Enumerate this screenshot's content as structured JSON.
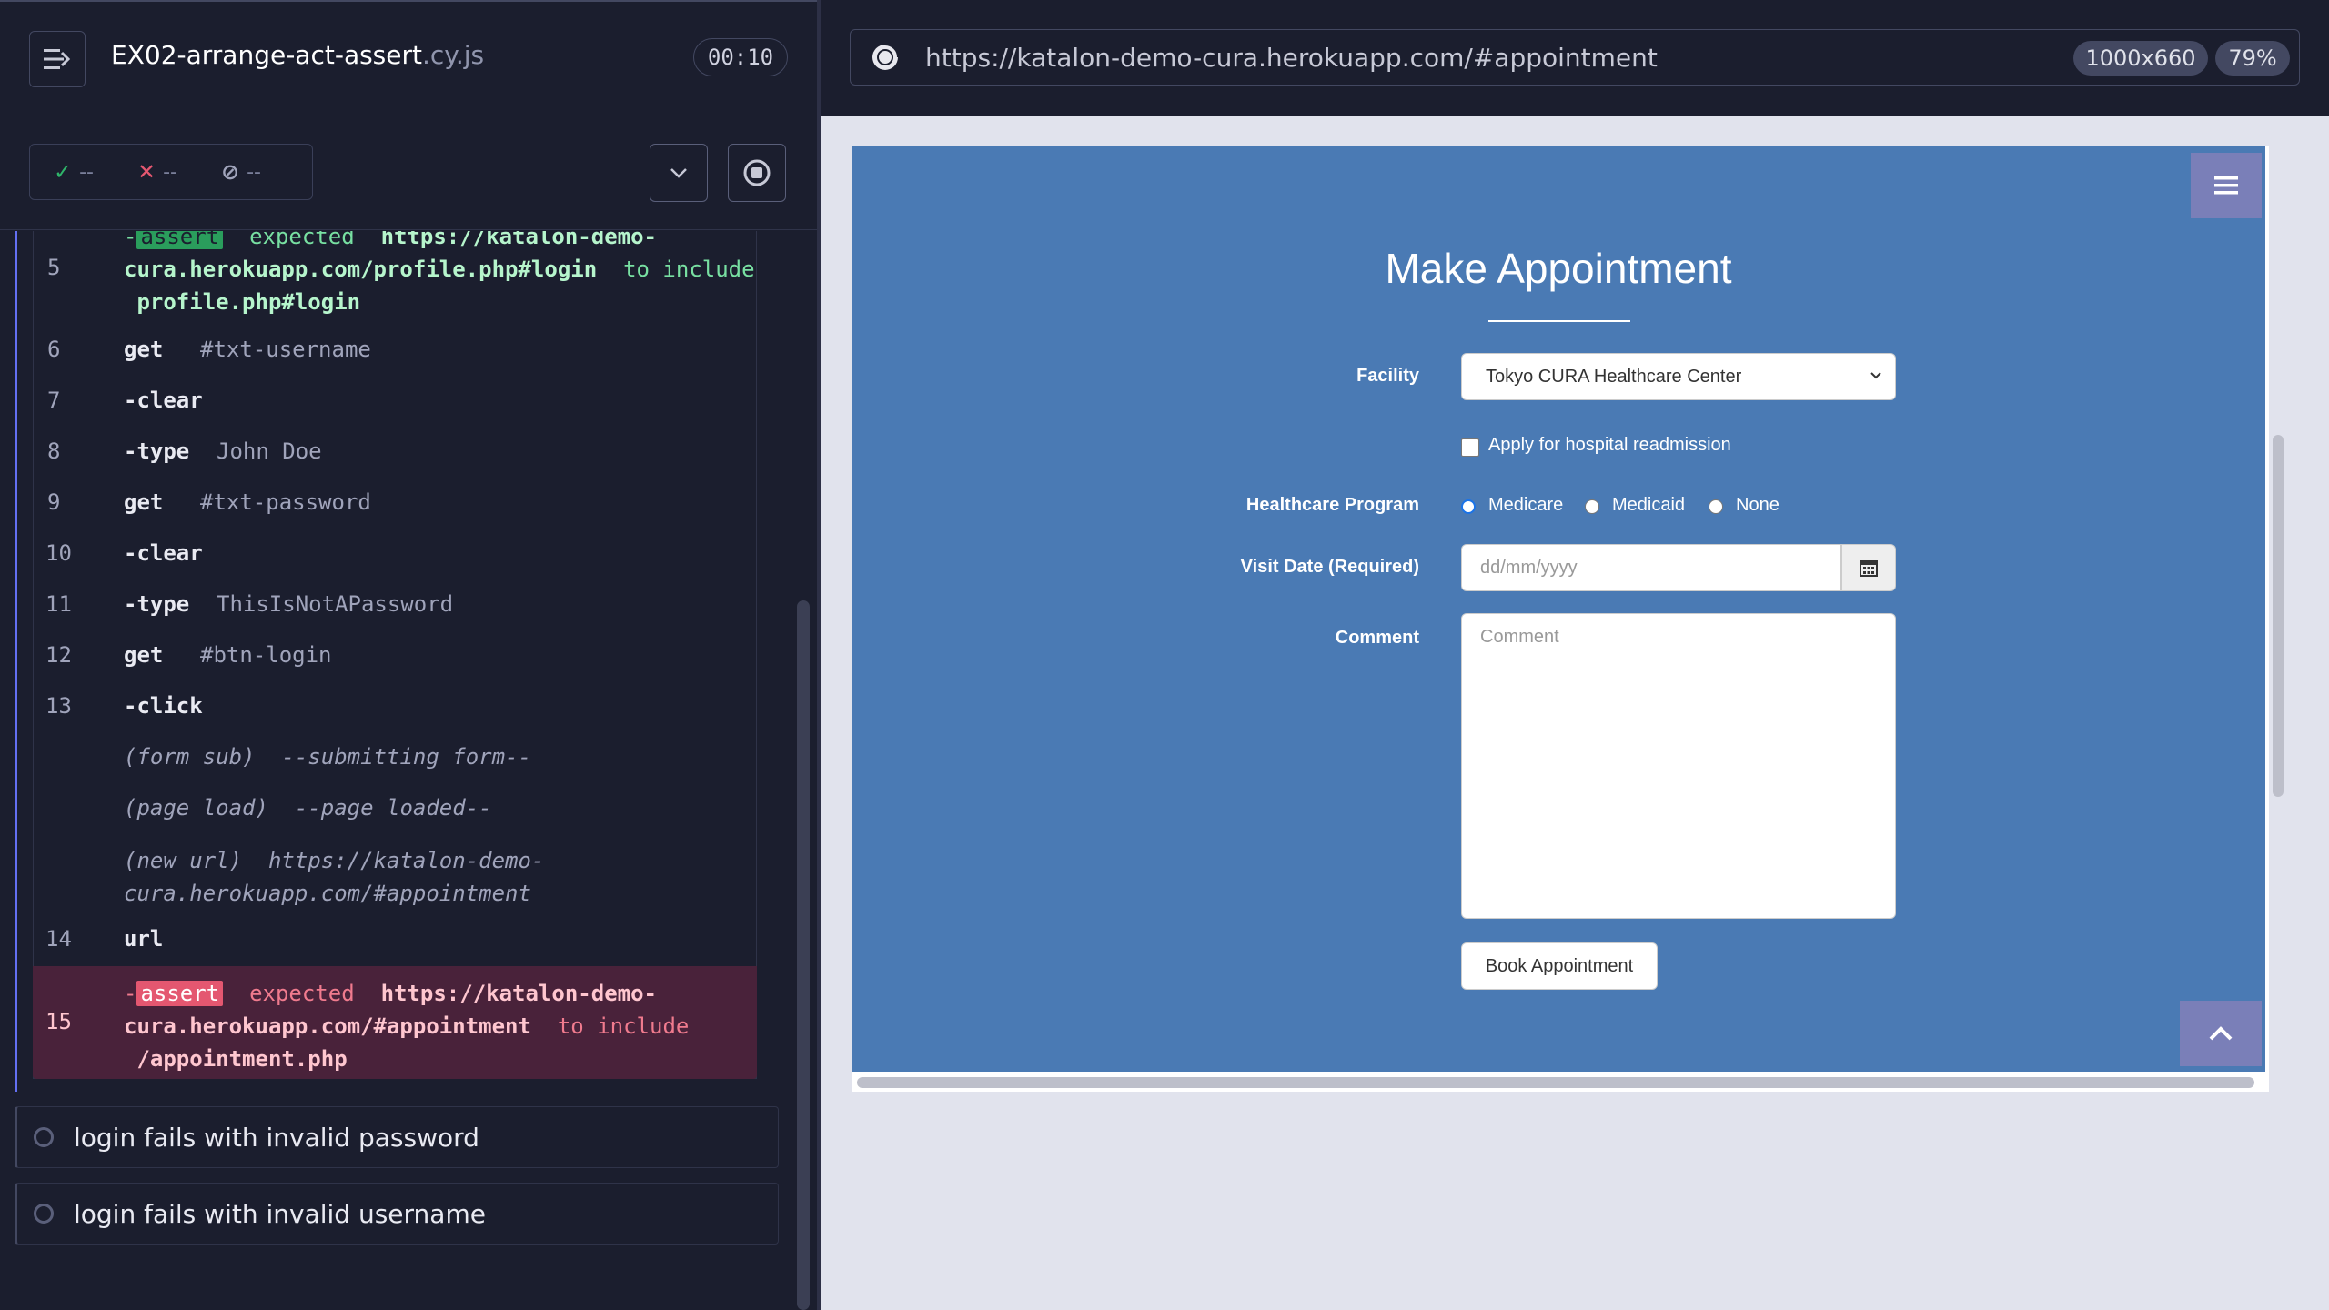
{
  "reporter": {
    "spec_name": "EX02-arrange-act-assert",
    "spec_ext": ".cy.js",
    "timer": "00:10",
    "stats": {
      "passed": "--",
      "failed": "--",
      "pending": "--"
    },
    "commands": {
      "assert_top": {
        "line1_pre": "-",
        "tag": "assert",
        "line1_expected": "expected",
        "line1_url": "https://katalon-demo-",
        "line2_url": "cura.herokuapp.com/profile.php#login",
        "to_include": "to include",
        "line3": "profile.php#login",
        "num": "5"
      },
      "rows": [
        {
          "num": "6",
          "cmd": "get",
          "arg": "#txt-username"
        },
        {
          "num": "7",
          "cmd": "-clear",
          "arg": ""
        },
        {
          "num": "8",
          "cmd": "-type",
          "arg": "John Doe"
        },
        {
          "num": "9",
          "cmd": "get",
          "arg": "#txt-password"
        },
        {
          "num": "10",
          "cmd": "-clear",
          "arg": ""
        },
        {
          "num": "11",
          "cmd": "-type",
          "arg": "ThisIsNotAPassword"
        },
        {
          "num": "12",
          "cmd": "get",
          "arg": "#btn-login"
        },
        {
          "num": "13",
          "cmd": "-click",
          "arg": ""
        }
      ],
      "events": {
        "form_sub": "(form sub)",
        "form_sub_msg": "--submitting form--",
        "page_load": "(page load)",
        "page_load_msg": "--page loaded--",
        "new_url": "(new url)",
        "new_url_1": "https://katalon-demo-",
        "new_url_2": "cura.herokuapp.com/#appointment"
      },
      "url_row": {
        "num": "14",
        "cmd": "url"
      },
      "assert_fail": {
        "num": "15",
        "pre": "-",
        "tag": "assert",
        "expected": "expected",
        "url1": "https://katalon-demo-",
        "url2": "cura.herokuapp.com/#appointment",
        "to_include": "to include",
        "line3": "/appointment.php"
      }
    },
    "tests": [
      {
        "label": "login fails with invalid password"
      },
      {
        "label": "login fails with invalid username"
      }
    ]
  },
  "aut": {
    "url": "https://katalon-demo-cura.herokuapp.com/#appointment",
    "viewport": "1000x660",
    "zoom": "79%",
    "page": {
      "title": "Make Appointment",
      "facility_label": "Facility",
      "facility_value": "Tokyo CURA Healthcare Center",
      "readmission_label": "Apply for hospital readmission",
      "program_label": "Healthcare Program",
      "programs": [
        "Medicare",
        "Medicaid",
        "None"
      ],
      "visit_label": "Visit Date (Required)",
      "visit_placeholder": "dd/mm/yyyy",
      "comment_label": "Comment",
      "comment_placeholder": "Comment",
      "book_button": "Book Appointment"
    }
  },
  "colors": {
    "brand_blue": "#4a7ab4",
    "pass": "#78e0a2",
    "fail": "#e45770",
    "accent": "#6470f3"
  }
}
